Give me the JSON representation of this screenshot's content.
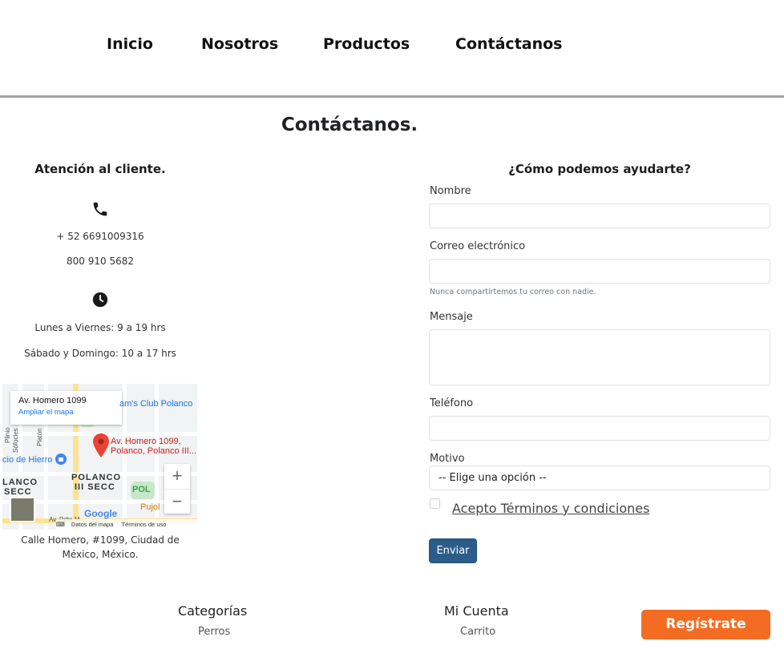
{
  "nav": {
    "items": [
      "Inicio",
      "Nosotros",
      "Productos",
      "Contáctanos"
    ]
  },
  "page_title": "Contáctanos.",
  "support": {
    "heading": "Atención al cliente.",
    "phone_icon": "phone-icon",
    "phone_1": "+ 52 6691009316",
    "phone_2": "800 910 5682",
    "clock_icon": "clock-icon",
    "hours_weekdays": "Lunes a Viernes: 9 a 19 hrs",
    "hours_weekend": "Sábado y Domingo: 10 a 17 hrs"
  },
  "map": {
    "info_title": "Av. Homero 1099",
    "info_link": "Ampliar el mapa",
    "pin_label_1": "Av. Homero 1099,",
    "pin_label_2": "Polanco, Polanco III...",
    "poi_club": "am's Club Polanco",
    "poi_hierro": "cio de Hierro",
    "area_1": "POLANCO",
    "area_2": "III SECC",
    "area_left_1": "LANCO",
    "area_left_2": "SECC",
    "poi_pujol": "Pujol",
    "poi_pol": "POL",
    "street_plinio": "Plinio",
    "street_sofocles": "Sófocles",
    "street_platon": "Platón",
    "street_av": "Av. Pdte M",
    "google": "Google",
    "zoom_in": "+",
    "zoom_out": "−",
    "foot_data": "Datos del mapa",
    "foot_terms": "Términos de uso"
  },
  "address": {
    "line1": "Calle Homero, #1099, Ciudad de",
    "line2": "México, México."
  },
  "form": {
    "heading": "¿Cómo podemos ayudarte?",
    "name_label": "Nombre",
    "email_label": "Correo electrónico",
    "email_help": "Nunca compartirtemos tu correo con nadie.",
    "message_label": "Mensaje",
    "phone_label": "Teléfono",
    "reason_label": "Motivo",
    "reason_selected": "-- Elige una opción --",
    "terms_label": "Acepto Términos y condiciones",
    "submit_label": "Enviar"
  },
  "footer": {
    "col1_heading": "Categorías",
    "col1_item": "Perros",
    "col2_heading": "Mi Cuenta",
    "col2_item": "Carrito",
    "register_label": "Regístrate"
  },
  "colors": {
    "accent_blue": "#2c5d8a",
    "accent_orange": "#f36c21"
  }
}
